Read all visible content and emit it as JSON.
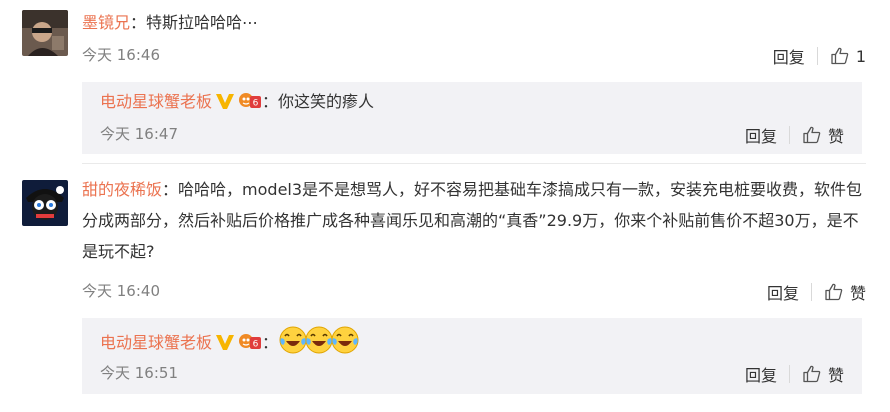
{
  "comments": [
    {
      "user": "墨镜兄",
      "text": "特斯拉哈哈哈⋯",
      "time": "今天 16:46",
      "reply_label": "回复",
      "like_label": "1",
      "replies": [
        {
          "user": "电动星球蟹老板",
          "text": "你这笑的瘆人",
          "time": "今天 16:47",
          "reply_label": "回复",
          "like_label": "赞"
        }
      ]
    },
    {
      "user": "甜的夜稀饭",
      "text": "哈哈哈，model3是不是想骂人，好不容易把基础车漆搞成只有一款，安装充电桩要收费，软件包分成两部分，然后补贴后价格推广成各种喜闻乐见和高潮的“真香”29.9万，你来个补贴前售价不超30万，是不是玩不起?",
      "time": "今天 16:40",
      "reply_label": "回复",
      "like_label": "赞",
      "replies": [
        {
          "user": "电动星球蟹老板",
          "text": "",
          "emoji_count": 3,
          "time": "今天 16:51",
          "reply_label": "回复",
          "like_label": "赞"
        }
      ]
    }
  ],
  "colors": {
    "username": "#eb7350",
    "meta": "#808080",
    "reply_bg": "#f2f2f5",
    "vip": "#f7b500"
  },
  "colon": "："
}
